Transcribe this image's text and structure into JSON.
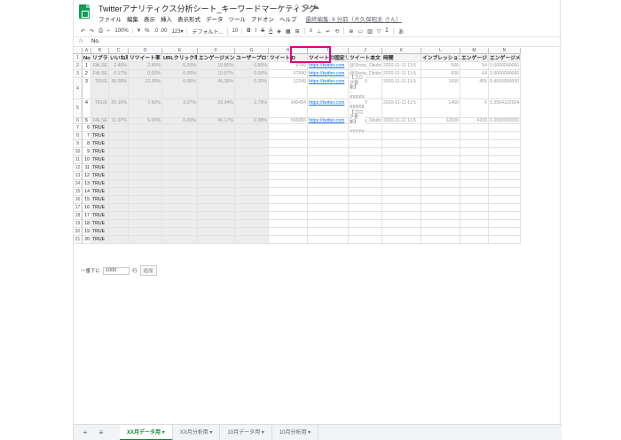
{
  "doc": {
    "title": "Twitterアナリティクス分析シート_キーワードマーケティング",
    "last_edit": "最終編集: 8 分前（大久保昭太 さん）"
  },
  "menu": [
    "ファイル",
    "編集",
    "表示",
    "挿入",
    "表示形式",
    "データ",
    "ツール",
    "アドオン",
    "ヘルプ"
  ],
  "toolbar": {
    "zoom": "100%",
    "currency": "¥",
    "percent": "%",
    "decimals": ".0  .00",
    "format": "123▾",
    "font": "デフォルト...",
    "font_size": "10",
    "bold": "B",
    "italic": "I",
    "strike": "S",
    "textcolor": "A"
  },
  "formula": {
    "fx": "fx",
    "value": "No."
  },
  "columns": [
    "A",
    "B",
    "C",
    "D",
    "E",
    "F",
    "G",
    "H",
    "I",
    "J",
    "K",
    "L",
    "M",
    "N"
  ],
  "headers": [
    "No",
    "リプライ",
    "いいね率",
    "リツイート率",
    "URLクリック率",
    "エンゲージメント",
    "ユーザープロフィール",
    "ツイートID",
    "ツイートの固定リンク",
    "ツイート本文",
    "時間",
    "インプレッション",
    "エンゲージメント",
    "エンゲージメント"
  ],
  "rows": [
    {
      "r": "2",
      "no": "1",
      "b": "FALSE",
      "c": "2.40%",
      "d": "2.40%",
      "e": "0.20%",
      "f": "10.80%",
      "g": "0.80%",
      "h": "6789",
      "i": "https://twitter.com",
      "j": "@Shota_Okubo",
      "k": "2020-11-11 11:5",
      "l": "500",
      "m": "54",
      "n": "1.0000000000"
    },
    {
      "r": "3",
      "no": "2",
      "b": "FALSE",
      "c": "0.17%",
      "d": "0.00%",
      "e": "0.00%",
      "f": "10.67%",
      "g": "0.00%",
      "h": "67890",
      "i": "https://twitter.com",
      "j": "@Shota_Okubo",
      "k": "2020-11-11 11:5",
      "l": "600",
      "m": "64",
      "n": "1.0000000000"
    },
    {
      "r": "4",
      "no": "3",
      "b": "TRUE",
      "c": "30.00%",
      "d": "12.30%",
      "e": "0.00%",
      "f": "45.30%",
      "g": "0.30%",
      "h": "12345",
      "i": "https://twitter.com",
      "j": "- XXXXX",
      "k": "2020-11-11 11:5",
      "l": "1000",
      "m": "455",
      "n": "0.4500000000"
    },
    {
      "r": "5",
      "no": "4",
      "b": "TRUE",
      "c": "20.10%",
      "d": "7.60%",
      "e": "3.37%",
      "f": "20.94%",
      "g": "2.79%",
      "h": "345454",
      "i": "https://twitter.com",
      "j": "- YYYYY",
      "k": "2020-11-11 11:5",
      "l": "1460",
      "m": "6",
      "n": "0.3564102564"
    },
    {
      "r": "6",
      "no": "5",
      "b": "FALSE",
      "c": "11.07%",
      "d": "5.00%",
      "e": "0.00%",
      "f": "45.17%",
      "g": "0.38%",
      "h": "565656",
      "i": "https://twitter.com",
      "j": "@Shota_Okubo",
      "k": "2020-11-11 11:5",
      "l": "12000",
      "m": "4200",
      "n": "0.3500000000"
    }
  ],
  "tweet_lines": [
    "【ブログ更新】",
    "- XXXXX",
    "- XXXXX",
    "【ブログ更新】",
    "- YYYYY"
  ],
  "empty_rows": [
    {
      "r": "7",
      "no": "6",
      "b": "TRUE"
    },
    {
      "r": "8",
      "no": "7",
      "b": "TRUE"
    },
    {
      "r": "9",
      "no": "8",
      "b": "TRUE"
    },
    {
      "r": "10",
      "no": "9",
      "b": "TRUE"
    },
    {
      "r": "11",
      "no": "10",
      "b": "TRUE"
    },
    {
      "r": "12",
      "no": "11",
      "b": "TRUE"
    },
    {
      "r": "13",
      "no": "12",
      "b": "TRUE"
    },
    {
      "r": "14",
      "no": "13",
      "b": "TRUE"
    },
    {
      "r": "15",
      "no": "14",
      "b": "TRUE"
    },
    {
      "r": "16",
      "no": "15",
      "b": "TRUE"
    },
    {
      "r": "17",
      "no": "16",
      "b": "TRUE"
    },
    {
      "r": "18",
      "no": "17",
      "b": "TRUE"
    },
    {
      "r": "19",
      "no": "18",
      "b": "TRUE"
    },
    {
      "r": "20",
      "no": "19",
      "b": "TRUE"
    },
    {
      "r": "21",
      "no": "20",
      "b": "TRUE"
    }
  ],
  "add_rows": {
    "prefix": "一番下に",
    "count": "1000",
    "suffix": "行",
    "button": "追加"
  },
  "tabs": [
    "XX月データ用",
    "XX月分析用",
    "10月データ用",
    "10月分析用"
  ],
  "colors": {
    "accent": "#188038",
    "highlight": "#e6007e",
    "link": "#1a73e8"
  }
}
